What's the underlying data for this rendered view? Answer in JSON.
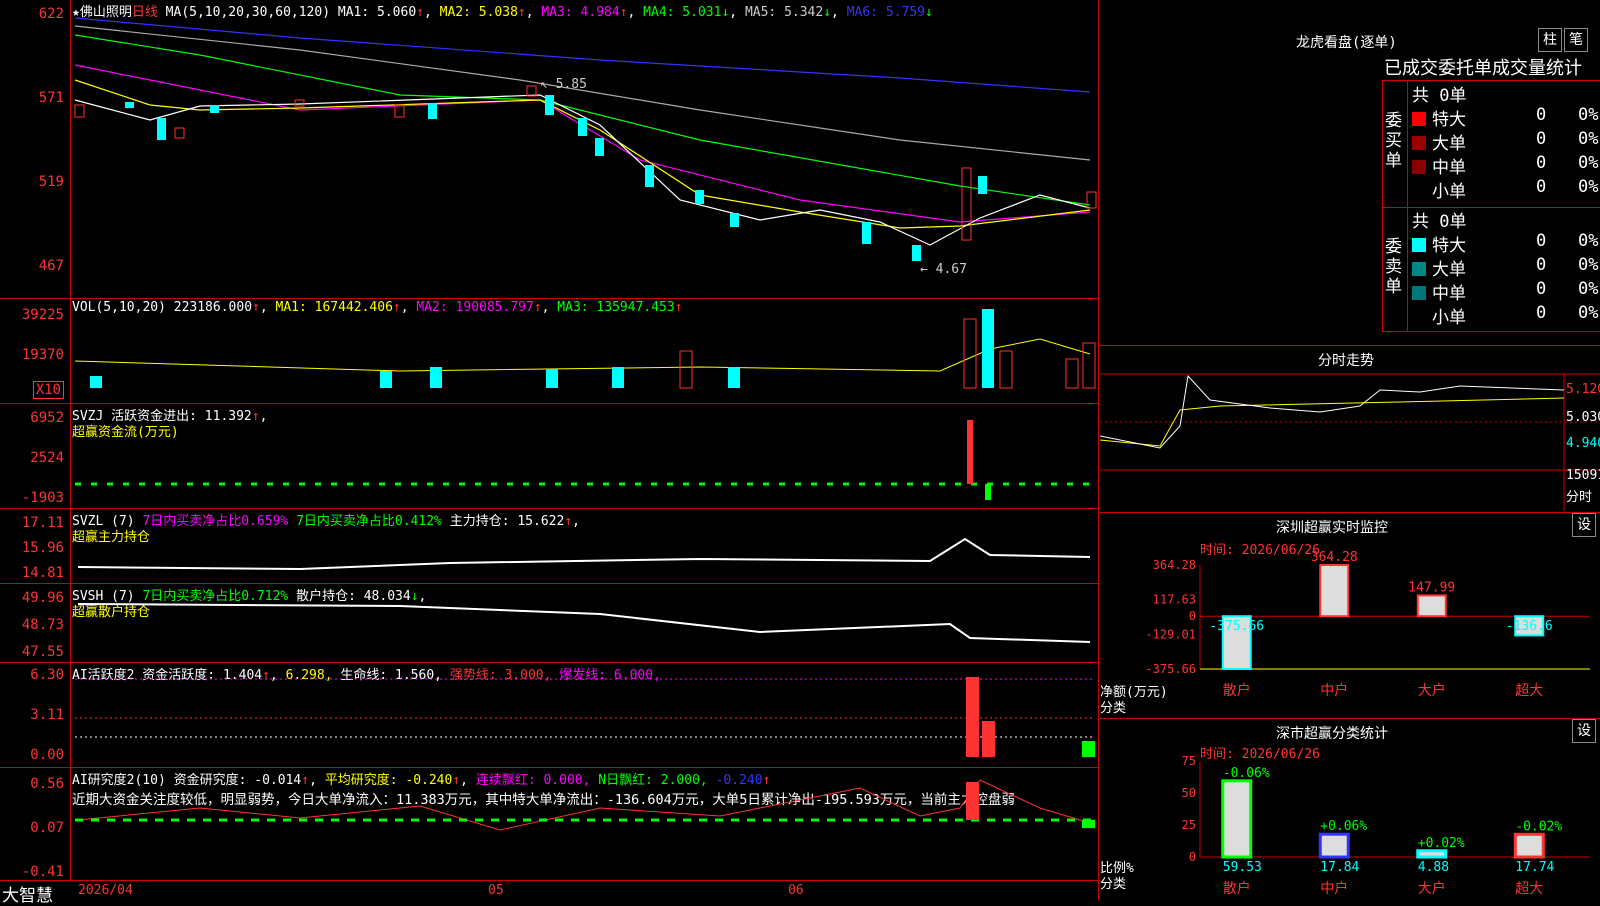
{
  "stock": {
    "title": "★佛山照明",
    "period": "日线",
    "ma_params": "MA(5,10,20,30,60,120)",
    "ma1": "MA1: 5.060",
    "ma2": "MA2: 5.038",
    "ma3": "MA3: 4.984",
    "ma4": "MA4: 5.031",
    "ma5": "MA5: 5.342",
    "ma6": "MA6: 5.759",
    "high_mark": "5.85",
    "low_mark": "4.67"
  },
  "colors": {
    "up": "#ff3333",
    "down": "#00ffff",
    "grid": "#cc0000",
    "ma1": "#ffffff",
    "ma2": "#ffff00",
    "ma3": "#ff00ff",
    "ma4": "#00ff00",
    "ma5": "#aaaaaa",
    "ma6": "#3333ff"
  },
  "price_axis": [
    "622",
    "571",
    "519",
    "467"
  ],
  "vol": {
    "header": "VOL(5,10,20)",
    "value": "223186.000",
    "ma1": "MA1: 167442.406",
    "ma2": "MA2: 190085.797",
    "ma3": "MA3: 135947.453",
    "ticks": [
      "39225",
      "19370"
    ],
    "unit": "X10"
  },
  "svzj": {
    "header": "SVZJ  活跃资金进出: 11.392",
    "sub": "超赢资金流(万元)",
    "ticks": [
      "6952",
      "2524",
      "-1903"
    ]
  },
  "svzl": {
    "header_a": "SVZL (7)",
    "header_b": "7日内买卖净占比0.659%",
    "header_c": "7日内买卖净占比0.412%",
    "header_d": "主力持仓: 15.622",
    "sub": "超赢主力持仓",
    "ticks": [
      "17.11",
      "15.96",
      "14.81"
    ]
  },
  "svsh": {
    "header_a": "SVSH (7)",
    "header_b": "7日内买卖净占比0.712%",
    "header_c": "散户持仓: 48.034",
    "sub": "超赢散户持仓",
    "ticks": [
      "49.96",
      "48.73",
      "47.55"
    ]
  },
  "ai1": {
    "h1": "AI活跃度2 资金活跃度: 1.404",
    "h2": "6.298,",
    "h3": "生命线: 1.560,",
    "h4": "强势线: 3.000,",
    "h5": "爆发线: 6.000,",
    "ticks": [
      "6.30",
      "3.11",
      "0.00"
    ]
  },
  "ai2": {
    "h1": "AI研究度2(10) 资金研究度: -0.014",
    "h2": "平均研究度: -0.240",
    "h3": "连续飘红: 0.000,",
    "h4": "N日飘红: 2.000,",
    "h5": "-0.240",
    "comment": "近期大资金关注度较低，明显弱势，今日大单净流入：11.383万元，其中特大单净流出：-136.604万元，大单5日累计净出-195.593万元，当前主力控盘弱",
    "ticks": [
      "0.56",
      "0.07",
      "-0.41"
    ]
  },
  "bottom": {
    "brand": "大智慧",
    "date1": "2026/04",
    "date2": "05",
    "date3": "06"
  },
  "longhu": {
    "title": "龙虎看盘(逐单)",
    "btn1": "柱",
    "btn2": "笔",
    "subtitle": "已成交委托单成交量统计",
    "buy_label": "委买单",
    "sell_label": "委卖单",
    "buy_total": "共 0单",
    "sell_total": "共 0单",
    "rows": [
      {
        "label": "特大",
        "count": "0",
        "pct": "0%"
      },
      {
        "label": "大单",
        "count": "0",
        "pct": "0%"
      },
      {
        "label": "中单",
        "count": "0",
        "pct": "0%"
      },
      {
        "label": "小单",
        "count": "0",
        "pct": "0%"
      }
    ]
  },
  "fenshi": {
    "title": "分时走势",
    "p1": "5.120",
    "p2": "5.030",
    "p3": "4.940",
    "vol": "15091",
    "label": "分时"
  },
  "monitor": {
    "title": "深圳超赢实时监控",
    "btn": "设",
    "time": "时间: 2026/06/26",
    "ticks": [
      "364.28",
      "117.63",
      "0",
      "-129.01",
      "-375.66"
    ],
    "ylabel": "净额(万元)",
    "xlabel": "分类",
    "cats": [
      "散户",
      "中户",
      "大户",
      "超大"
    ],
    "labels": [
      "-375.66",
      "364.28",
      "147.99",
      "-136.6"
    ]
  },
  "classify": {
    "title": "深市超赢分类统计",
    "btn": "设",
    "time": "时间: 2026/06/26",
    "ticks": [
      "75",
      "50",
      "25",
      "0"
    ],
    "ylabel": "比例%",
    "xlabel": "分类",
    "cats": [
      "散户",
      "中户",
      "大户",
      "超大"
    ],
    "top": [
      "-0.06%",
      "+0.06%",
      "+0.02%",
      "-0.02%"
    ],
    "bot": [
      "59.53",
      "17.84",
      "4.88",
      "17.74"
    ]
  },
  "chart_data": [
    {
      "type": "bar",
      "title": "深圳超赢实时监控",
      "categories": [
        "散户",
        "中户",
        "大户",
        "超大"
      ],
      "values": [
        -375.66,
        364.28,
        147.99,
        -136.6
      ],
      "ylabel": "净额(万元)",
      "xlabel": "分类",
      "ylim": [
        -375.66,
        364.28
      ]
    },
    {
      "type": "bar",
      "title": "深市超赢分类统计",
      "categories": [
        "散户",
        "中户",
        "大户",
        "超大"
      ],
      "values": [
        59.53,
        17.84,
        4.88,
        17.74
      ],
      "ylabel": "比例%",
      "xlabel": "分类",
      "ylim": [
        0,
        75
      ]
    }
  ]
}
